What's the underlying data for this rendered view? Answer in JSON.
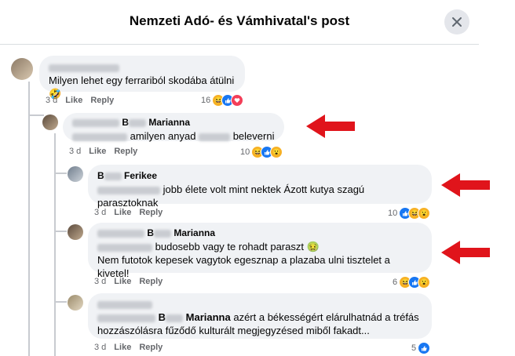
{
  "header": {
    "title": "Nemzeti Adó- és Vámhivatal's post"
  },
  "comments": [
    {
      "name": "",
      "text": "Milyen lehet egy ferrariból skodába átülni 🤣",
      "time": "3 d",
      "like": "Like",
      "reply": "Reply",
      "reaction_count": "16"
    },
    {
      "name_suffix": "B",
      "name_tail": "Marianna",
      "text": "amilyen anyad",
      "text_tail": "beleverni",
      "time": "3 d",
      "like": "Like",
      "reply": "Reply",
      "reaction_count": "10"
    },
    {
      "name_prefix": "B",
      "name_tail": "Ferikee",
      "text": "jobb élete volt mint nektek Ázott kutya szagú parasztoknak",
      "time": "3 d",
      "like": "Like",
      "reply": "Reply",
      "reaction_count": "10"
    },
    {
      "name_prefix": "B",
      "name_tail": "Marianna",
      "text": "budosebb vagy te rohadt paraszt 🤢",
      "text2": "Nem futotok kepesek vagytok egesznap a plazaba ulni tisztelet a kivetel!",
      "time": "3 d",
      "like": "Like",
      "reply": "Reply",
      "reaction_count": "6"
    },
    {
      "mention_prefix": "B",
      "mention_tail": "Marianna",
      "text": "azért a békességért elárulhatnád a tréfás",
      "text2": "hozzászólásra fűződő kulturált megjegyzésed miből fakadt...",
      "time": "3 d",
      "like": "Like",
      "reply": "Reply",
      "reaction_count": "5"
    }
  ],
  "colors": {
    "arrow": "#e0141b",
    "like_blue": "#1877f2",
    "love_red": "#f33e58",
    "haha_yellow": "#f7b125"
  }
}
